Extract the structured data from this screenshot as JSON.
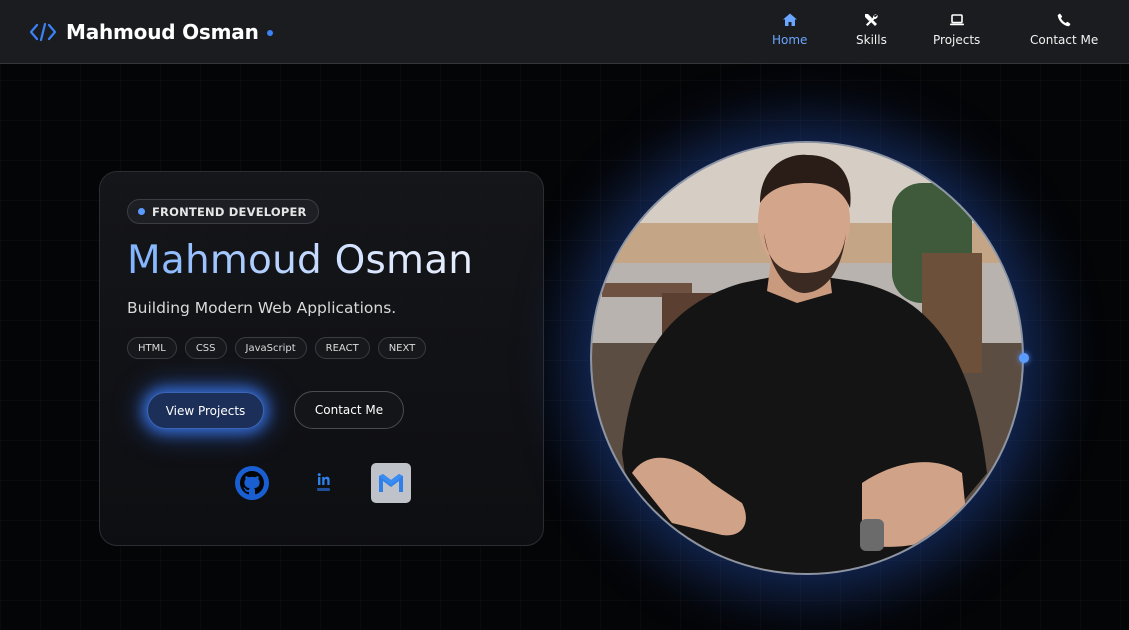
{
  "brand": {
    "name": "Mahmoud Osman",
    "icon": "code-icon",
    "accent": "#3b82f6"
  },
  "nav": {
    "items": [
      {
        "label": "Home",
        "icon": "home-icon",
        "active": true
      },
      {
        "label": "Skills",
        "icon": "tools-icon",
        "active": false
      },
      {
        "label": "Projects",
        "icon": "laptop-icon",
        "active": false
      },
      {
        "label": "Contact Me",
        "icon": "phone-icon",
        "active": false
      }
    ]
  },
  "hero": {
    "role": "FRONTEND DEVELOPER",
    "name": "Mahmoud Osman",
    "tagline": "Building Modern Web Applications.",
    "tech": [
      "HTML",
      "CSS",
      "JavaScript",
      "REACT",
      "NEXT"
    ],
    "primary_button": "View Projects",
    "secondary_button": "Contact Me",
    "socials": [
      {
        "icon": "github-icon"
      },
      {
        "icon": "linkedin-icon"
      },
      {
        "icon": "gmail-icon"
      }
    ]
  },
  "colors": {
    "background": "#040507",
    "navbar": "#1b1c1f",
    "accent": "#3b82f6",
    "name_gradient_start": "#7fb2ff"
  }
}
